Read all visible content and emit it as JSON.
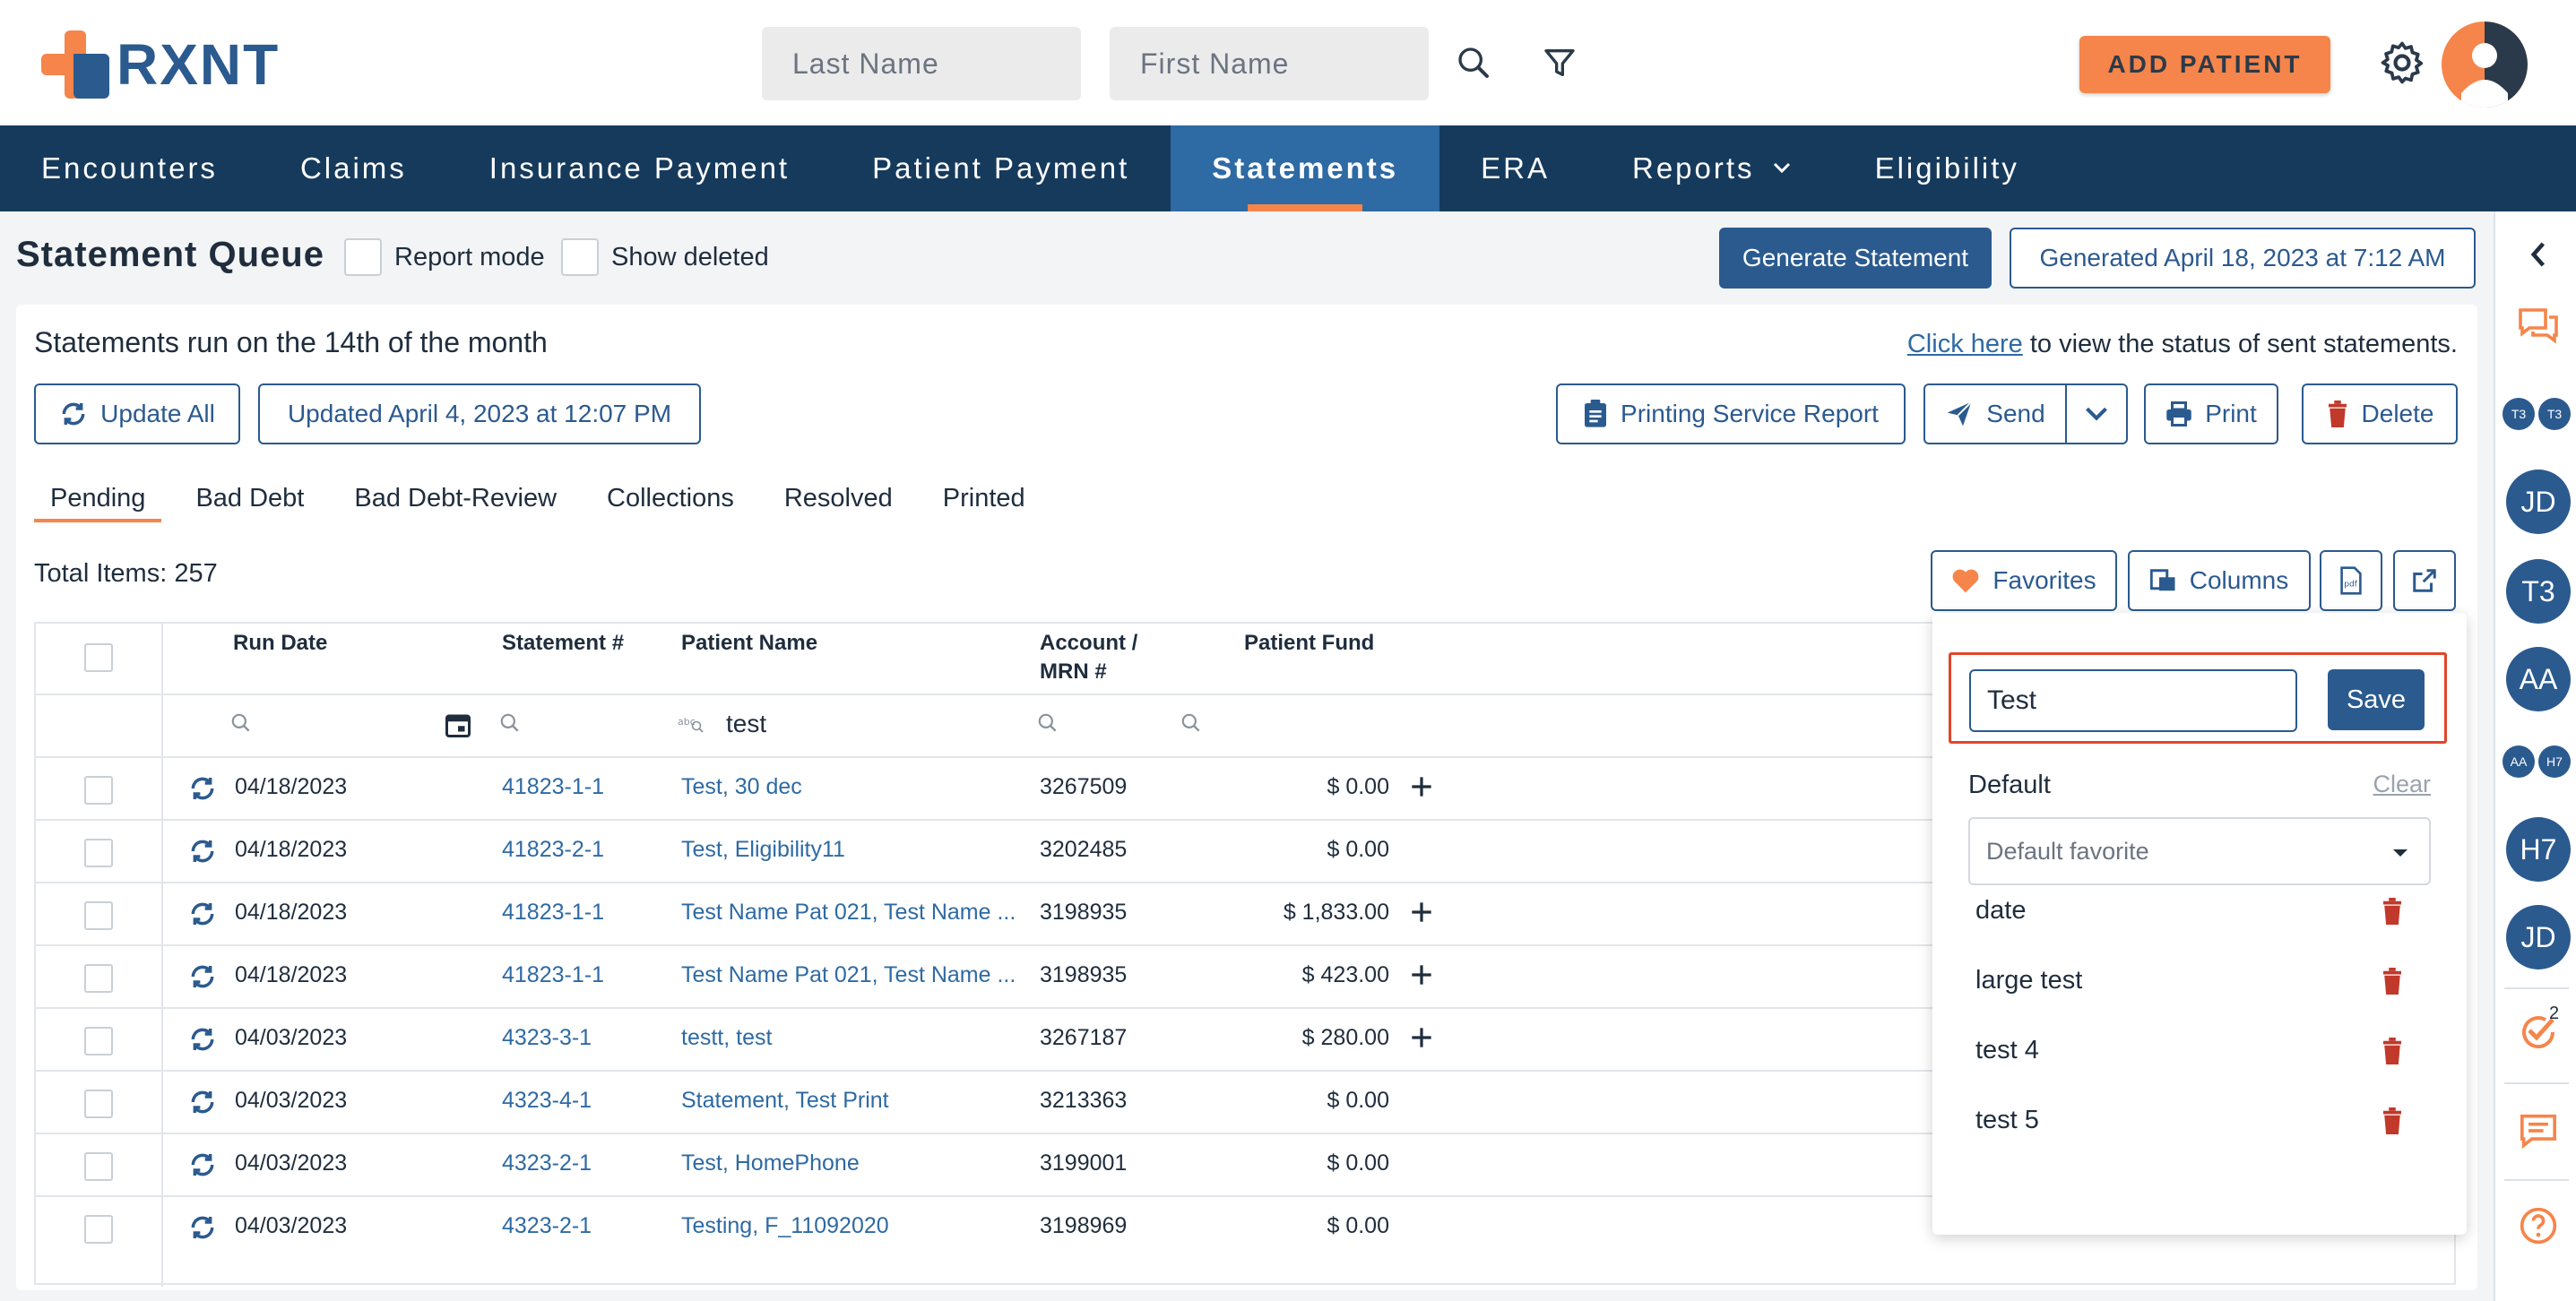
{
  "brand": {
    "name": "RXNT"
  },
  "header": {
    "last_name_placeholder": "Last Name",
    "first_name_placeholder": "First Name",
    "add_patient": "ADD PATIENT"
  },
  "nav": {
    "items": [
      {
        "label": "Encounters"
      },
      {
        "label": "Claims"
      },
      {
        "label": "Insurance Payment"
      },
      {
        "label": "Patient Payment"
      },
      {
        "label": "Statements",
        "active": true
      },
      {
        "label": "ERA"
      },
      {
        "label": "Reports",
        "has_dropdown": true
      },
      {
        "label": "Eligibility"
      }
    ]
  },
  "page": {
    "title": "Statement Queue",
    "report_mode": "Report mode",
    "show_deleted": "Show deleted",
    "generate_statement": "Generate Statement",
    "generated_at": "Generated April 18, 2023 at 7:12 AM",
    "run_note": "Statements run on the 14th of the month",
    "click_here": "Click here",
    "status_note": "to view the status of sent statements.",
    "update_all": "Update All",
    "updated_at": "Updated April 4, 2023 at 12:07 PM",
    "printing_service_report": "Printing Service Report",
    "send": "Send",
    "print": "Print",
    "delete": "Delete",
    "total_items": "Total Items: 257",
    "favorites": "Favorites",
    "columns": "Columns"
  },
  "tabs": [
    {
      "label": "Pending",
      "active": true
    },
    {
      "label": "Bad Debt"
    },
    {
      "label": "Bad Debt-Review"
    },
    {
      "label": "Collections"
    },
    {
      "label": "Resolved"
    },
    {
      "label": "Printed"
    }
  ],
  "table": {
    "headers": {
      "run_date": "Run Date",
      "statement": "Statement #",
      "patient_name": "Patient Name",
      "account_line1": "Account /",
      "account_line2": "MRN #",
      "patient_fund": "Patient Fund"
    },
    "patient_filter_value": "test",
    "rows": [
      {
        "date": "04/18/2023",
        "statement": "41823-1-1",
        "name": "Test, 30 dec",
        "account": "3267509",
        "fund": "$ 0.00",
        "plus": true
      },
      {
        "date": "04/18/2023",
        "statement": "41823-2-1",
        "name": "Test, Eligibility11",
        "account": "3202485",
        "fund": "$ 0.00",
        "plus": false
      },
      {
        "date": "04/18/2023",
        "statement": "41823-1-1",
        "name": "Test Name Pat 021, Test Name ...",
        "account": "3198935",
        "fund": "$ 1,833.00",
        "plus": true
      },
      {
        "date": "04/18/2023",
        "statement": "41823-1-1",
        "name": "Test Name Pat 021, Test Name ...",
        "account": "3198935",
        "fund": "$ 423.00",
        "plus": true
      },
      {
        "date": "04/03/2023",
        "statement": "4323-3-1",
        "name": "testt, test",
        "account": "3267187",
        "fund": "$ 280.00",
        "plus": true
      },
      {
        "date": "04/03/2023",
        "statement": "4323-4-1",
        "name": "Statement, Test Print",
        "account": "3213363",
        "fund": "$ 0.00",
        "plus": false
      },
      {
        "date": "04/03/2023",
        "statement": "4323-2-1",
        "name": "Test, HomePhone",
        "account": "3199001",
        "fund": "$ 0.00",
        "plus": false
      },
      {
        "date": "04/03/2023",
        "statement": "4323-2-1",
        "name": "Testing, F_11092020",
        "account": "3198969",
        "fund": "$ 0.00",
        "plus": false
      }
    ]
  },
  "favorites_popover": {
    "name_value": "Test",
    "save": "Save",
    "default_label": "Default",
    "clear": "Clear",
    "default_placeholder": "Default favorite",
    "items": [
      "date",
      "large test",
      "test 4",
      "test 5"
    ]
  },
  "rail": {
    "small_badges": [
      "T3",
      "T3",
      "AA",
      "H7"
    ],
    "avatars": [
      "JD",
      "T3",
      "AA",
      "H7",
      "JD"
    ],
    "task_count": "2"
  },
  "colors": {
    "brand_blue": "#2b5a8f",
    "nav_dark": "#163a5c",
    "accent_orange": "#f5854a",
    "danger": "#c0392b",
    "highlight_red": "#e0452a"
  }
}
